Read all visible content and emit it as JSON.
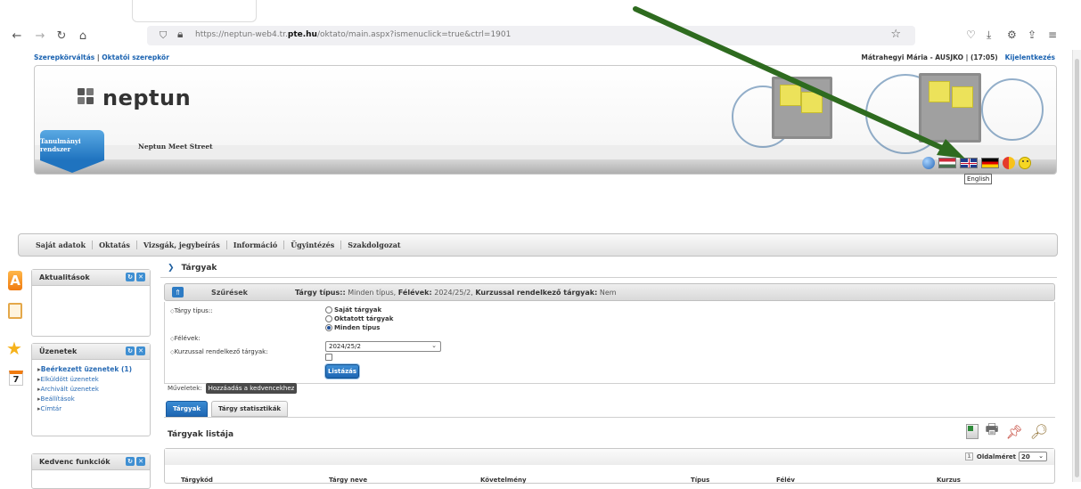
{
  "browser": {
    "url_prefix": "https://neptun-web4.tr.",
    "url_domain": "pte.hu",
    "url_path": "/oktato/main.aspx?ismenuclick=true&ctrl=1901"
  },
  "topline": {
    "role_switch": "Szerepkörváltás",
    "role_current": "Oktatói szerepkör",
    "user": "Mátrahegyi Mária - AUSJKO",
    "timer": "(17:05)",
    "logout": "Kijelentkezés"
  },
  "header": {
    "logo_text": "neptun",
    "system_badge": "Tanulmányi rendszer",
    "meet_street": "Neptun Meet Street",
    "tooltip": "English"
  },
  "main_menu": [
    "Saját adatok",
    "Oktatás",
    "Vizsgák, jegybeírás",
    "Információ",
    "Ügyintézés",
    "Szakdolgozat"
  ],
  "sidebar": {
    "news_title": "Aktualitások",
    "messages_title": "Üzenetek",
    "messages": [
      "Beérkezett üzenetek (1)",
      "Elküldött üzenetek",
      "Archivált üzenetek",
      "Beállítások",
      "Címtár"
    ],
    "favorites_title": "Kedvenc funkciók",
    "calendar_day": "7"
  },
  "content": {
    "title": "Tárgyak",
    "filter_label": "Szűrések",
    "filter_summary_prefix1": "Tárgy típus::",
    "filter_summary_val1": " Minden típus, ",
    "filter_summary_prefix2": "Félévek:",
    "filter_summary_val2": " 2024/25/2, ",
    "filter_summary_prefix3": "Kurzussal rendelkező tárgyak:",
    "filter_summary_val3": " Nem",
    "subject_type_label": "Tárgy típus::",
    "radio_options": [
      "Saját tárgyak",
      "Oktatott tárgyak",
      "Minden típus"
    ],
    "semester_label": "Félévek:",
    "semester_value": "2024/25/2",
    "course_label": "Kurzussal rendelkező tárgyak:",
    "list_button": "Listázás",
    "operations_label": "Műveletek:",
    "add_favorite": "Hozzáadás a kedvencekhez",
    "tabs": [
      "Tárgyak",
      "Tárgy statisztikák"
    ],
    "list_title": "Tárgyak listája",
    "page_size_label": "Oldalméret",
    "page_size_value": "20",
    "page_number": "1",
    "columns": [
      "Tárgykód",
      "Tárgy neve",
      "Követelmény",
      "Típus",
      "Félév",
      "Kurzus"
    ]
  },
  "colors": {
    "accent_blue": "#1f73bf",
    "link_blue": "#1a62b0",
    "arrow_green": "#2e6b1f"
  }
}
